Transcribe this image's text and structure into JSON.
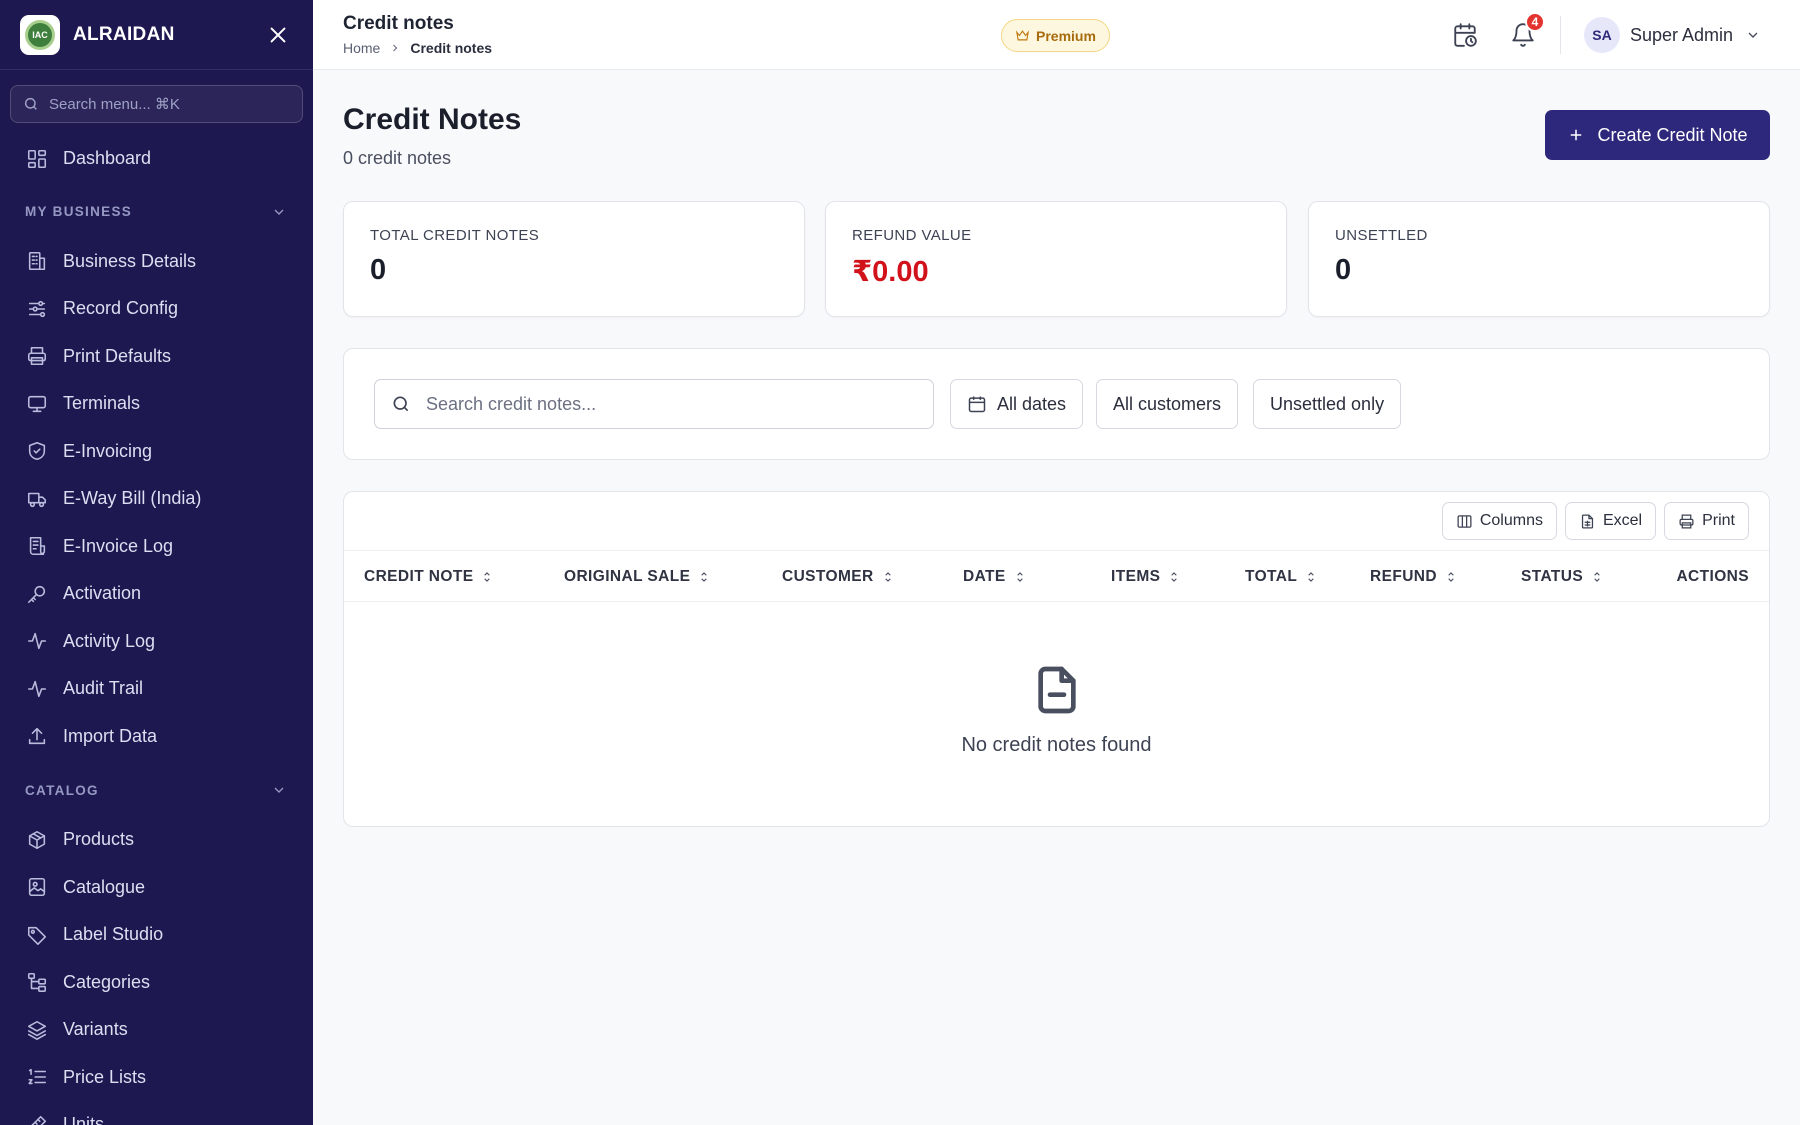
{
  "brand": {
    "name": "ALRAIDAN",
    "logo_text": "IAC"
  },
  "sidebar": {
    "search_placeholder": "Search menu... ⌘K",
    "dashboard": {
      "label": "Dashboard",
      "icon": "dashboard-icon"
    },
    "sections": [
      {
        "title": "MY BUSINESS",
        "items": [
          {
            "label": "Business Details",
            "icon": "building-icon"
          },
          {
            "label": "Record Config",
            "icon": "sliders-icon"
          },
          {
            "label": "Print Defaults",
            "icon": "printer-icon"
          },
          {
            "label": "Terminals",
            "icon": "monitor-icon"
          },
          {
            "label": "E-Invoicing",
            "icon": "shield-check-icon"
          },
          {
            "label": "E-Way Bill (India)",
            "icon": "truck-icon"
          },
          {
            "label": "E-Invoice Log",
            "icon": "receipt-icon"
          },
          {
            "label": "Activation",
            "icon": "key-icon"
          },
          {
            "label": "Activity Log",
            "icon": "activity-icon"
          },
          {
            "label": "Audit Trail",
            "icon": "activity-icon"
          },
          {
            "label": "Import Data",
            "icon": "upload-icon"
          }
        ]
      },
      {
        "title": "CATALOG",
        "items": [
          {
            "label": "Products",
            "icon": "package-icon"
          },
          {
            "label": "Catalogue",
            "icon": "image-icon"
          },
          {
            "label": "Label Studio",
            "icon": "tag-icon"
          },
          {
            "label": "Categories",
            "icon": "tree-icon"
          },
          {
            "label": "Variants",
            "icon": "layers-icon"
          },
          {
            "label": "Price Lists",
            "icon": "list-icon"
          },
          {
            "label": "Units",
            "icon": "ruler-icon"
          }
        ]
      }
    ]
  },
  "header": {
    "title": "Credit notes",
    "breadcrumb": {
      "home": "Home",
      "current": "Credit notes"
    },
    "premium_label": "Premium",
    "notification_count": "4",
    "user": {
      "initials": "SA",
      "name": "Super Admin"
    }
  },
  "page": {
    "title": "Credit Notes",
    "subtitle": "0 credit notes",
    "create_button": "Create Credit Note"
  },
  "stats": [
    {
      "label": "TOTAL CREDIT NOTES",
      "value": "0"
    },
    {
      "label": "REFUND VALUE",
      "value": "₹0.00"
    },
    {
      "label": "UNSETTLED",
      "value": "0"
    }
  ],
  "colors": {
    "sidebar_bg": "#1e1850",
    "accent": "#2e287c",
    "refund_value": "#d2121b",
    "badge": "#e3342f",
    "premium_text": "#a86b0c"
  },
  "filters": {
    "search_placeholder": "Search credit notes...",
    "date": "All dates",
    "customers": "All customers",
    "unsettled": "Unsettled only"
  },
  "table": {
    "toolbar": {
      "columns": "Columns",
      "excel": "Excel",
      "print": "Print"
    },
    "headers": [
      "CREDIT NOTE",
      "ORIGINAL SALE",
      "CUSTOMER",
      "DATE",
      "ITEMS",
      "TOTAL",
      "REFUND",
      "STATUS",
      "ACTIONS"
    ],
    "empty_message": "No credit notes found"
  }
}
